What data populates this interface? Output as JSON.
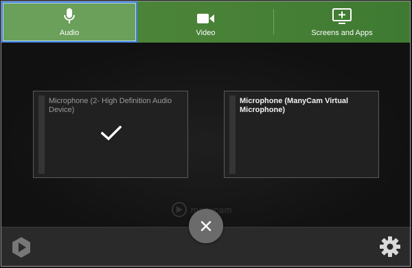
{
  "tabs": {
    "audio": {
      "label": "Audio",
      "icon": "microphone-icon"
    },
    "video": {
      "label": "Video",
      "icon": "video-camera-icon"
    },
    "screens": {
      "label": "Screens and Apps",
      "icon": "screen-add-icon"
    }
  },
  "devices": [
    {
      "name": "Microphone (2- High Definition Audio Device)",
      "selected": true
    },
    {
      "name": "Microphone (ManyCam Virtual Microphone)",
      "selected": false
    }
  ],
  "watermark": {
    "text": "manycam"
  },
  "colors": {
    "tab_bar": "#4a8338",
    "active_tab": "#6aa05a",
    "active_outline": "#3d7fe0",
    "background": "#141414",
    "bottom_bar": "#2a2a2a"
  },
  "icons": {
    "close": "close-icon",
    "settings": "gear-icon",
    "logo": "app-logo-icon",
    "selected": "checkmark-icon"
  }
}
